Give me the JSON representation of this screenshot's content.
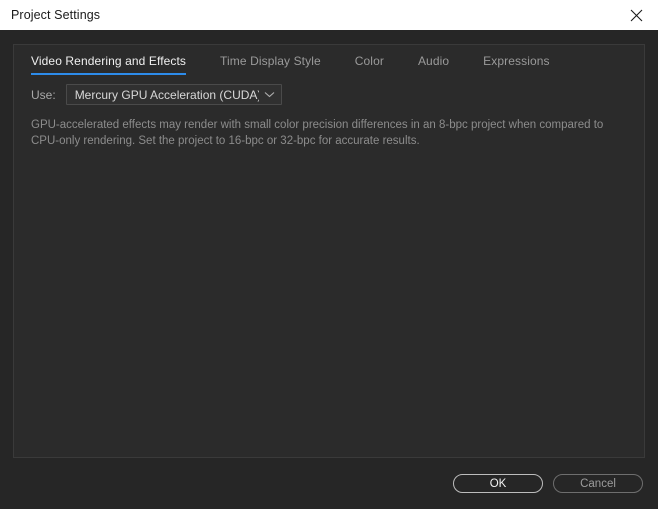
{
  "window": {
    "title": "Project Settings",
    "close_icon": "close-icon"
  },
  "tabs": [
    {
      "label": "Video Rendering and Effects",
      "active": true
    },
    {
      "label": "Time Display Style",
      "active": false
    },
    {
      "label": "Color",
      "active": false
    },
    {
      "label": "Audio",
      "active": false
    },
    {
      "label": "Expressions",
      "active": false
    }
  ],
  "settings": {
    "use_label": "Use:",
    "renderer": {
      "value": "Mercury GPU Acceleration (CUDA)",
      "arrow_icon": "chevron-down-icon"
    },
    "description": "GPU-accelerated effects may render with small color precision differences in an 8-bpc project when compared to CPU-only rendering. Set the project to 16-bpc or 32-bpc for accurate results."
  },
  "footer": {
    "ok_label": "OK",
    "cancel_label": "Cancel"
  },
  "colors": {
    "accent": "#2d8ceb",
    "titlebar_bg": "#ffffff",
    "window_bg": "#262626",
    "panel_bg": "#2b2b2b"
  }
}
